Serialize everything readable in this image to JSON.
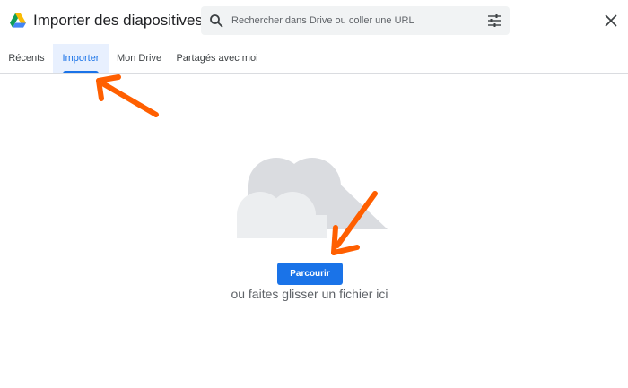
{
  "header": {
    "title": "Importer des diapositives",
    "search_placeholder": "Rechercher dans Drive ou coller une URL",
    "icons": {
      "logo": "google-drive-logo",
      "search": "search-icon",
      "filter": "tune-icon",
      "close": "close-icon"
    }
  },
  "tabs": [
    {
      "label": "Récents",
      "active": false
    },
    {
      "label": "Importer",
      "active": true
    },
    {
      "label": "Mon Drive",
      "active": false
    },
    {
      "label": "Partagés avec moi",
      "active": false
    }
  ],
  "upload": {
    "button_label": "Parcourir",
    "drop_text": "ou faites glisser un fichier ici"
  },
  "colors": {
    "accent": "#1a73e8",
    "active_tab_bg": "#e8f0fe",
    "annotation_arrow": "#ff5f00",
    "cloud_back": "#dadce0",
    "cloud_front": "#eceef0"
  }
}
